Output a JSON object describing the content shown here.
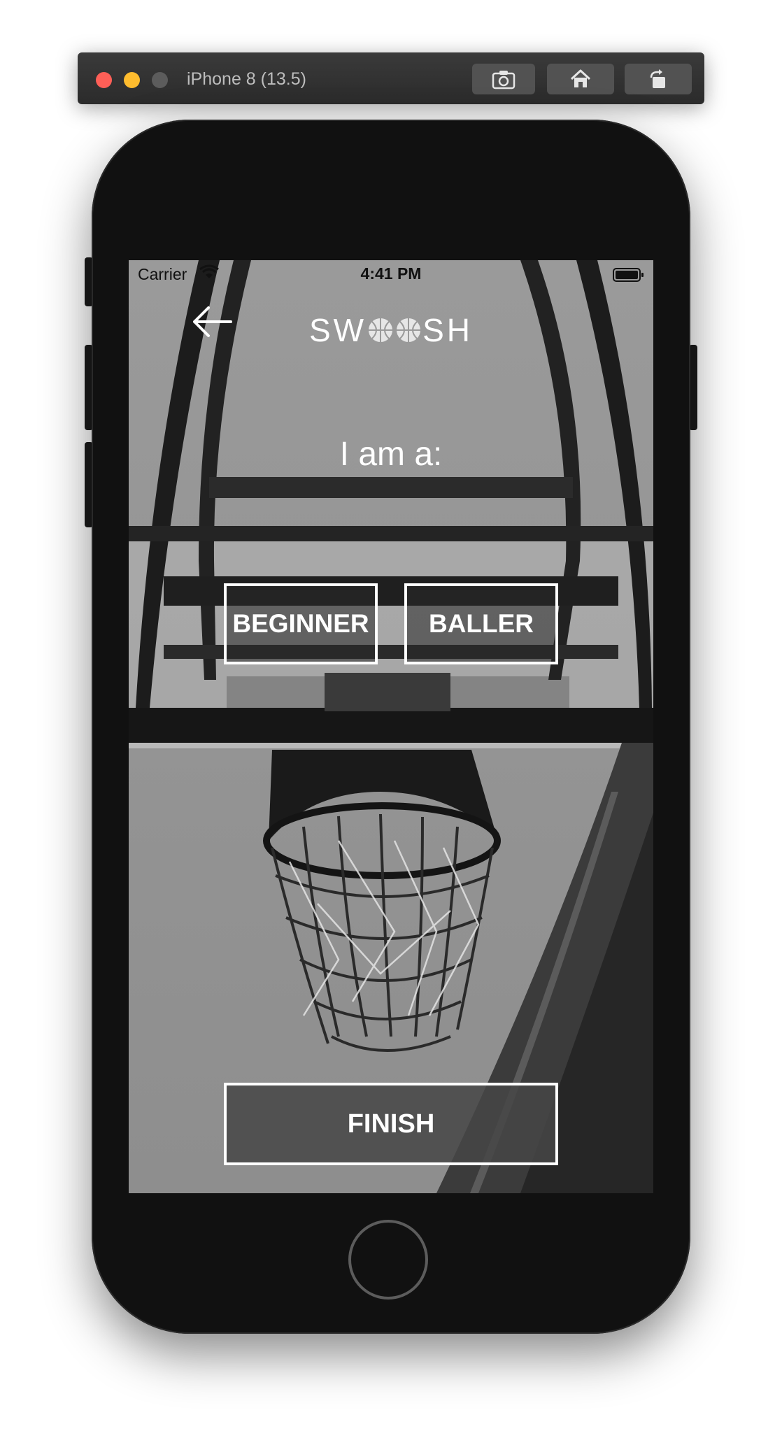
{
  "simulator": {
    "title": "iPhone 8 (13.5)",
    "buttons": [
      {
        "icon": "screenshot-icon"
      },
      {
        "icon": "home-icon"
      },
      {
        "icon": "rotate-icon"
      }
    ]
  },
  "status_bar": {
    "carrier": "Carrier",
    "time": "4:41 PM",
    "icons": [
      "wifi-icon",
      "battery-icon"
    ]
  },
  "nav": {
    "back_icon": "back-arrow-icon",
    "logo_text_left": "SW",
    "logo_text_right": "SH"
  },
  "main": {
    "prompt": "I am a:",
    "options": [
      {
        "label": "BEGINNER"
      },
      {
        "label": "BALLER"
      }
    ],
    "finish_label": "FINISH"
  },
  "colors": {
    "simulator_bar": "#2e2e2e",
    "phone_body": "#111111",
    "button_border": "#ffffff",
    "text": "#ffffff"
  }
}
